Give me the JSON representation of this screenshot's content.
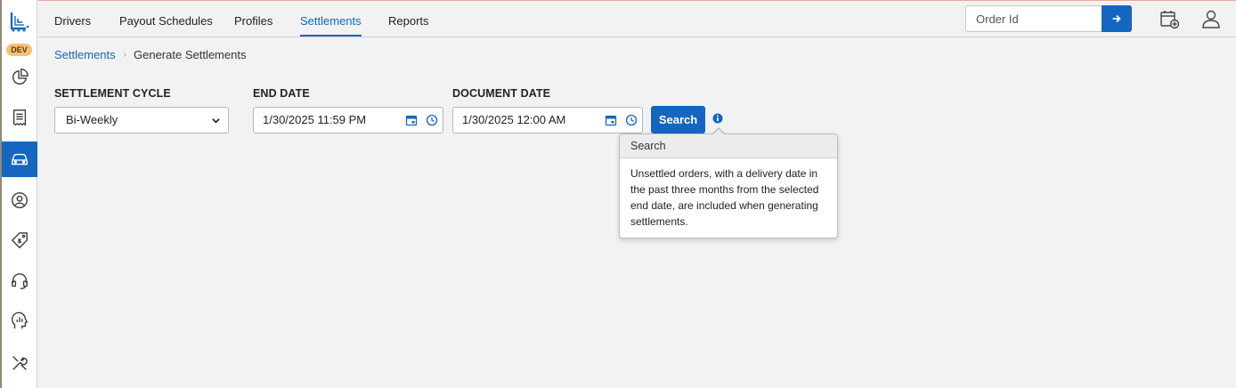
{
  "env_badge": "DEV",
  "nav": {
    "tabs": [
      {
        "label": "Drivers"
      },
      {
        "label": "Payout Schedules"
      },
      {
        "label": "Profiles"
      },
      {
        "label": "Settlements"
      },
      {
        "label": "Reports"
      }
    ],
    "active_tab": "Settlements"
  },
  "order_search": {
    "placeholder": "Order Id"
  },
  "breadcrumb": {
    "parent": "Settlements",
    "current": "Generate Settlements"
  },
  "form": {
    "settlement_cycle": {
      "label": "SETTLEMENT CYCLE",
      "value": "Bi-Weekly"
    },
    "end_date": {
      "label": "END DATE",
      "value": "1/30/2025 11:59 PM"
    },
    "document_date": {
      "label": "DOCUMENT DATE",
      "value": "1/30/2025 12:00 AM"
    },
    "search_label": "Search"
  },
  "popover": {
    "title": "Search",
    "body": "Unsettled orders, with a delivery date in the past three months from the selected end date, are included when generating settlements."
  },
  "colors": {
    "accent": "#1466c0",
    "badge": "#f5c07a"
  },
  "sidebar_icons": [
    "dashboard-icon",
    "receipt-icon",
    "car-icon",
    "user-icon",
    "price-tag-icon",
    "headset-icon",
    "analytics-icon",
    "tools-icon"
  ]
}
